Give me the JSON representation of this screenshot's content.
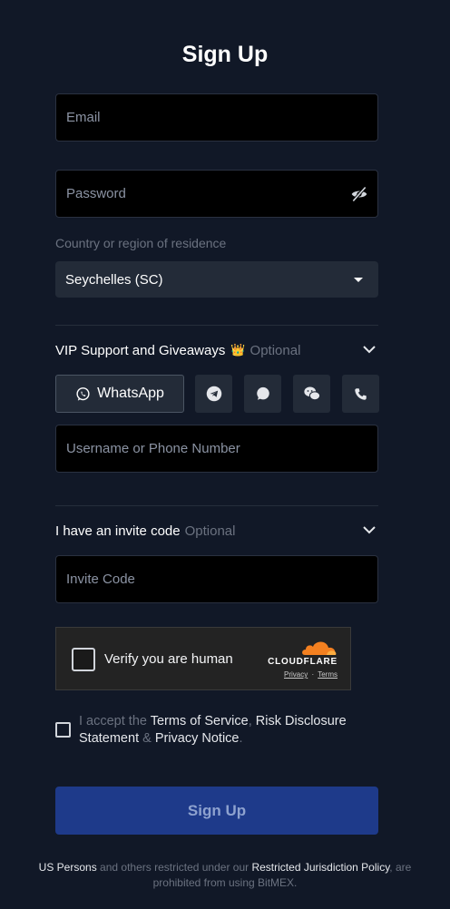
{
  "title": "Sign Up",
  "email": {
    "placeholder": "Email"
  },
  "password": {
    "placeholder": "Password"
  },
  "country": {
    "label": "Country or region of residence",
    "selected": "Seychelles (SC)"
  },
  "vip": {
    "title": "VIP Support and Giveaways",
    "optional": "Optional",
    "crown_glyph": "👑",
    "whatsapp_label": "WhatsApp",
    "channels": [
      "telegram-icon",
      "signal-icon",
      "wechat-icon",
      "phone-icon"
    ],
    "username_placeholder": "Username or Phone Number"
  },
  "invite": {
    "title": "I have an invite code",
    "optional": "Optional",
    "placeholder": "Invite Code"
  },
  "captcha": {
    "label": "Verify you are human",
    "brand": "CLOUDFLARE",
    "privacy": "Privacy",
    "sep": "·",
    "terms": "Terms"
  },
  "accept": {
    "prefix": "I accept the ",
    "terms": "Terms of Service",
    "comma": ", ",
    "risk": "Risk Disclosure Statement",
    "amp": " & ",
    "privacy": "Privacy Notice",
    "period": "."
  },
  "submit_label": "Sign Up",
  "footer": {
    "us": "US Persons",
    "mid": " and others restricted under our ",
    "policy": "Restricted Jurisdiction Policy",
    "end": ", are prohibited from using BitMEX."
  },
  "colors": {
    "background": "#111827",
    "field": "#000000",
    "select": "#232b38",
    "primary": "#1e3a8a",
    "cloudflare": "#f38020"
  }
}
